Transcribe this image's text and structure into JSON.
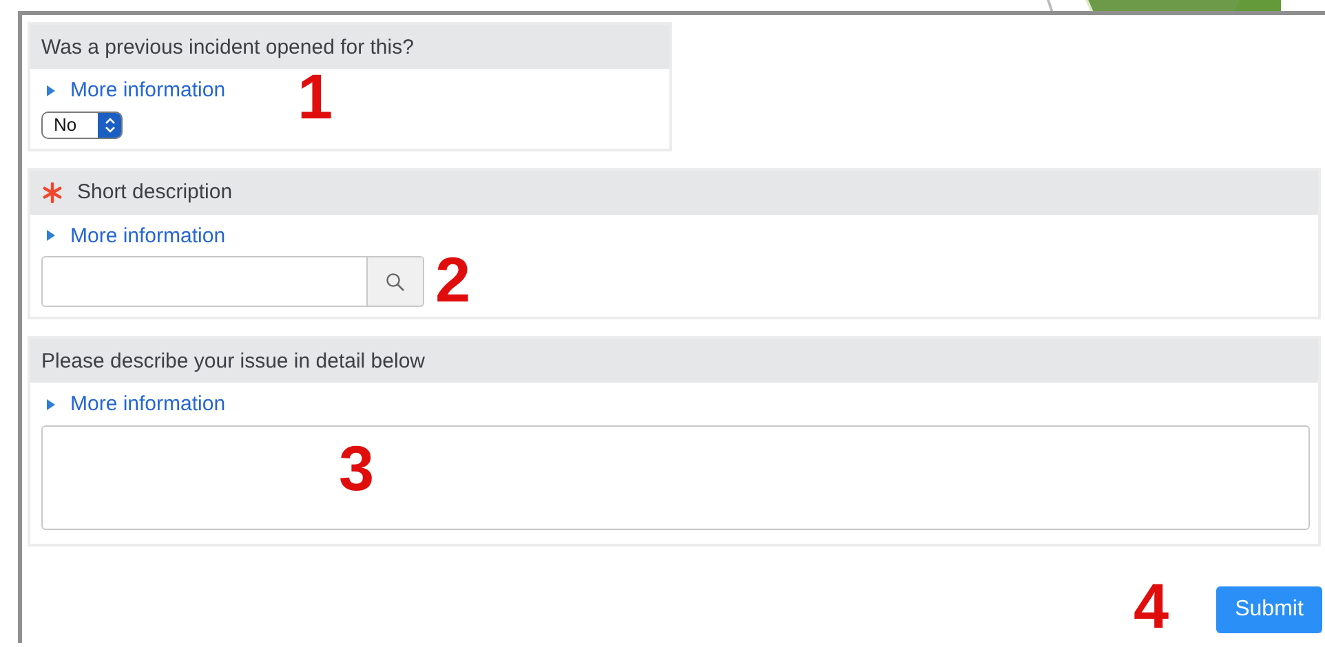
{
  "questions": [
    {
      "kind": "select",
      "label": "Was a previous incident opened for this?",
      "required": false,
      "more_info": "More information",
      "value": "No",
      "annotation": "1"
    },
    {
      "kind": "lookup",
      "label": "Short description",
      "required": true,
      "more_info": "More information",
      "annotation": "2"
    },
    {
      "kind": "textarea",
      "label": "Please describe your issue in detail below",
      "required": false,
      "more_info": "More information",
      "annotation": "3"
    }
  ],
  "submit": {
    "label": "Submit",
    "annotation": "4"
  }
}
